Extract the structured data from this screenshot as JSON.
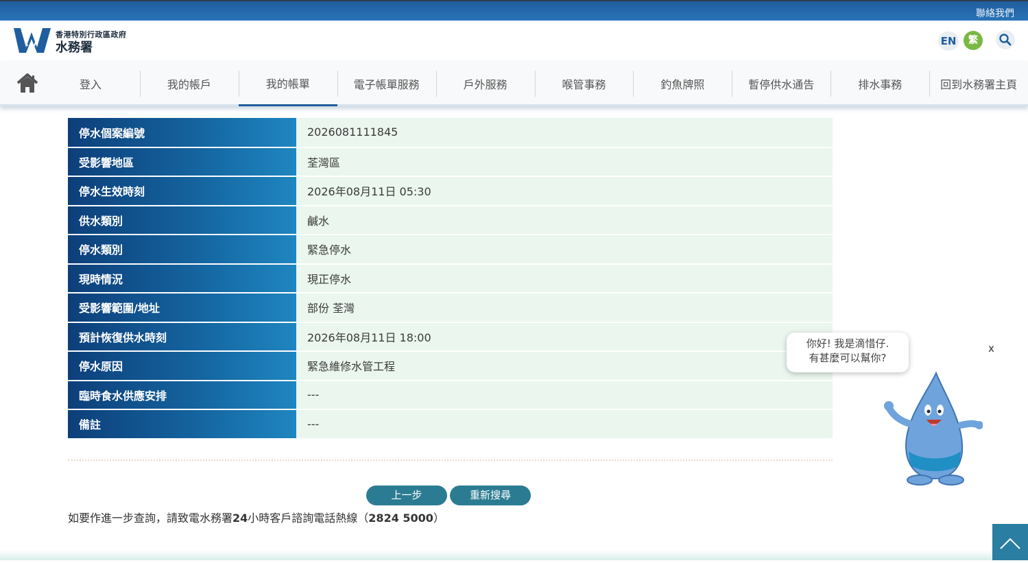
{
  "topbar": {
    "contact": "聯絡我們"
  },
  "header": {
    "logo_line1": "香港特別行政區政府",
    "logo_line2": "水務署",
    "lang_en": "EN",
    "lang_tc": "繁"
  },
  "nav": {
    "items": [
      {
        "label": "登入"
      },
      {
        "label": "我的帳戶"
      },
      {
        "label": "我的帳單"
      },
      {
        "label": "電子帳單服務"
      },
      {
        "label": "戶外服務"
      },
      {
        "label": "喉管事務"
      },
      {
        "label": "釣魚牌照"
      },
      {
        "label": "暫停供水通告"
      },
      {
        "label": "排水事務"
      },
      {
        "label": "回到水務署主頁"
      }
    ]
  },
  "details": {
    "rows": [
      {
        "label": "停水個案編號",
        "value": "2026081111845"
      },
      {
        "label": "受影響地區",
        "value": "荃灣區"
      },
      {
        "label": "停水生效時刻",
        "value": "2026年08月11日 05:30"
      },
      {
        "label": "供水類別",
        "value": "鹹水"
      },
      {
        "label": "停水類別",
        "value": "緊急停水"
      },
      {
        "label": "現時情況",
        "value": "現正停水"
      },
      {
        "label": "受影響範圍/地址",
        "value": "部份 荃灣"
      },
      {
        "label": "預計恢復供水時刻",
        "value": "2026年08月11日 18:00"
      },
      {
        "label": "停水原因",
        "value": "緊急維修水管工程"
      },
      {
        "label": "臨時食水供應安排",
        "value": "---"
      },
      {
        "label": "備註",
        "value": "---"
      }
    ]
  },
  "buttons": {
    "back": "上一步",
    "reset": "重新搜尋"
  },
  "footer": {
    "note_prefix": "如要作進一步查詢，請致電水務署",
    "note_hours": "24",
    "note_middle": "小時客戶諮詢電話熱線（",
    "phone": "2824 5000",
    "note_suffix": "）"
  },
  "mascot": {
    "line1": "你好! 我是滴惜仔.",
    "line2": "有甚麼可以幫你?",
    "close": "x"
  },
  "colors": {
    "brand_blue": "#1f5e9e",
    "label_blue": "#14639e",
    "value_green_bg": "#eaf6ee",
    "button_teal": "#2b7c92",
    "lang_active_green": "#79b843"
  }
}
